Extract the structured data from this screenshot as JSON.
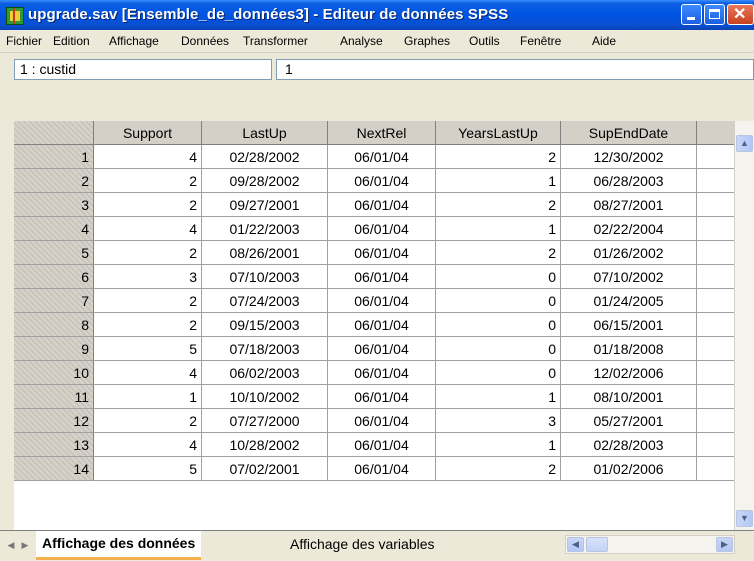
{
  "window": {
    "title": "upgrade.sav [Ensemble_de_données3] - Editeur de données SPSS"
  },
  "menu": [
    "Fichier",
    "Edition",
    "Affichage",
    "Données",
    "Transformer",
    "Analyse",
    "Graphes",
    "Outils",
    "Fenêtre",
    "Aide"
  ],
  "cell_editor": {
    "reference": "1 : custid",
    "value": "1"
  },
  "columns": [
    "Support",
    "LastUp",
    "NextRel",
    "YearsLastUp",
    "SupEndDate"
  ],
  "rows": [
    {
      "n": "1",
      "support": "4",
      "lastup": "02/28/2002",
      "nextrel": "06/01/04",
      "years": "2",
      "supend": "12/30/2002"
    },
    {
      "n": "2",
      "support": "2",
      "lastup": "09/28/2002",
      "nextrel": "06/01/04",
      "years": "1",
      "supend": "06/28/2003"
    },
    {
      "n": "3",
      "support": "2",
      "lastup": "09/27/2001",
      "nextrel": "06/01/04",
      "years": "2",
      "supend": "08/27/2001"
    },
    {
      "n": "4",
      "support": "4",
      "lastup": "01/22/2003",
      "nextrel": "06/01/04",
      "years": "1",
      "supend": "02/22/2004"
    },
    {
      "n": "5",
      "support": "2",
      "lastup": "08/26/2001",
      "nextrel": "06/01/04",
      "years": "2",
      "supend": "01/26/2002"
    },
    {
      "n": "6",
      "support": "3",
      "lastup": "07/10/2003",
      "nextrel": "06/01/04",
      "years": "0",
      "supend": "07/10/2002"
    },
    {
      "n": "7",
      "support": "2",
      "lastup": "07/24/2003",
      "nextrel": "06/01/04",
      "years": "0",
      "supend": "01/24/2005"
    },
    {
      "n": "8",
      "support": "2",
      "lastup": "09/15/2003",
      "nextrel": "06/01/04",
      "years": "0",
      "supend": "06/15/2001"
    },
    {
      "n": "9",
      "support": "5",
      "lastup": "07/18/2003",
      "nextrel": "06/01/04",
      "years": "0",
      "supend": "01/18/2008"
    },
    {
      "n": "10",
      "support": "4",
      "lastup": "06/02/2003",
      "nextrel": "06/01/04",
      "years": "0",
      "supend": "12/02/2006"
    },
    {
      "n": "11",
      "support": "1",
      "lastup": "10/10/2002",
      "nextrel": "06/01/04",
      "years": "1",
      "supend": "08/10/2001"
    },
    {
      "n": "12",
      "support": "2",
      "lastup": "07/27/2000",
      "nextrel": "06/01/04",
      "years": "3",
      "supend": "05/27/2001"
    },
    {
      "n": "13",
      "support": "4",
      "lastup": "10/28/2002",
      "nextrel": "06/01/04",
      "years": "1",
      "supend": "02/28/2003"
    },
    {
      "n": "14",
      "support": "5",
      "lastup": "07/02/2001",
      "nextrel": "06/01/04",
      "years": "2",
      "supend": "01/02/2006"
    }
  ],
  "tabs": {
    "data_view": "Affichage des données",
    "variable_view": "Affichage des variables"
  },
  "icons": {
    "app": "spss-data-editor-icon"
  }
}
